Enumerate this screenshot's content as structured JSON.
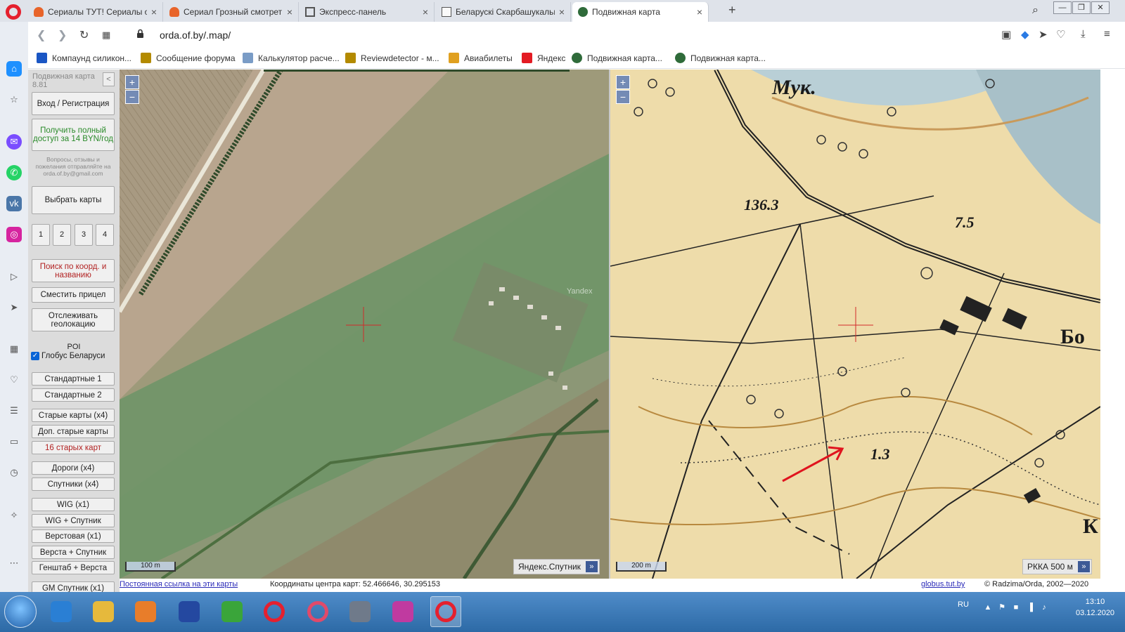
{
  "browser": {
    "tabs": [
      {
        "title": "Сериалы ТУТ! Сериалы он",
        "active": false
      },
      {
        "title": "Сериал Грозный смотрет",
        "active": false
      },
      {
        "title": "Экспресс-панель",
        "active": false
      },
      {
        "title": "Беларускі Скарбашукальн",
        "active": false
      },
      {
        "title": "Подвижная карта",
        "active": true
      }
    ],
    "new_tab_label": "+",
    "url": "orda.of.by/.map/",
    "window_controls": [
      "—",
      "❐",
      "✕"
    ]
  },
  "bookmarks": [
    {
      "label": "Компаунд силикон...",
      "color": "#1a56c4"
    },
    {
      "label": "Сообщение форума",
      "color": "#b38a00"
    },
    {
      "label": "Калькулятор расче...",
      "color": "#7a9cc6"
    },
    {
      "label": "Reviewdetector - м...",
      "color": "#b38a00"
    },
    {
      "label": "Авиабилеты",
      "color": "#e0a020"
    },
    {
      "label": "Яндекс",
      "color": "#e31b23"
    },
    {
      "label": "Подвижная карта...",
      "color": "#2f6b3a"
    },
    {
      "label": "Подвижная карта...",
      "color": "#2f6b3a"
    }
  ],
  "panel": {
    "title": "Подвижная карта",
    "version": "8.81",
    "collapse_label": "<",
    "login_label": "Вход / Регистрация",
    "full_access_label": "Получить полный доступ за 14 BYN/год",
    "note": "Вопросы, отзывы и пожелания отправляйте на orda.of.by@gmail.com",
    "choose_maps_label": "Выбрать карты",
    "layout_buttons": [
      "1",
      "2",
      "3",
      "4"
    ],
    "search_label": "Поиск по коорд. и названию",
    "shift_crosshair_label": "Сместить прицел",
    "track_geo_label": "Отслеживать геолокацию",
    "poi_label": "POI",
    "globus_label": "Глобус Беларуси",
    "globus_checked": true,
    "map_sets": [
      {
        "label": "Стандартные 1",
        "style": "normal"
      },
      {
        "label": "Стандартные 2",
        "style": "normal"
      },
      {
        "label": "Старые карты (x4)",
        "style": "normal"
      },
      {
        "label": "Доп. старые карты",
        "style": "normal"
      },
      {
        "label": "16 старых карт",
        "style": "red"
      },
      {
        "label": "Дороги (x4)",
        "style": "normal"
      },
      {
        "label": "Спутники (x4)",
        "style": "normal"
      },
      {
        "label": "WIG (x1)",
        "style": "normal"
      },
      {
        "label": "WIG + Спутник",
        "style": "normal"
      },
      {
        "label": "Верстовая (x1)",
        "style": "normal"
      },
      {
        "label": "Верста + Спутник",
        "style": "normal"
      },
      {
        "label": "Генштаб + Верста",
        "style": "normal"
      },
      {
        "label": "GM Спутник (x1)",
        "style": "normal"
      }
    ]
  },
  "map_left": {
    "zoom_in": "+",
    "zoom_out": "−",
    "scale": "100 m",
    "layer": "Яндекс.Спутник",
    "layer_arrow": "»",
    "watermark": "Yandex"
  },
  "map_right": {
    "zoom_in": "+",
    "zoom_out": "−",
    "scale": "200 m",
    "layer": "РККА 500 м",
    "layer_arrow": "»",
    "labels": [
      "Мук.",
      "136.3",
      "7.5",
      "1.3",
      "Бо",
      "К"
    ]
  },
  "status": {
    "permalink": "Постоянная ссылка на эти карты",
    "coords": "Координаты центра карт: 52.466646, 30.295153",
    "globus_link": "globus.tut.by",
    "copyright": "© Radzima/Orda, 2002—2020"
  },
  "taskbar": {
    "lang": "RU",
    "time": "13:10",
    "date": "03.12.2020",
    "apps": [
      {
        "name": "ie",
        "color": "#2a7fd4"
      },
      {
        "name": "explorer",
        "color": "#e6b93c"
      },
      {
        "name": "media",
        "color": "#e87d2a"
      },
      {
        "name": "save",
        "color": "#2448a0"
      },
      {
        "name": "green-a",
        "color": "#3aa53a"
      },
      {
        "name": "opera-1",
        "color": "#e5202e"
      },
      {
        "name": "opera-gx",
        "color": "#e04a6a"
      },
      {
        "name": "camera",
        "color": "#6f7a8a"
      },
      {
        "name": "gem",
        "color": "#c03aa0"
      },
      {
        "name": "opera-2",
        "color": "#e5202e"
      }
    ]
  }
}
